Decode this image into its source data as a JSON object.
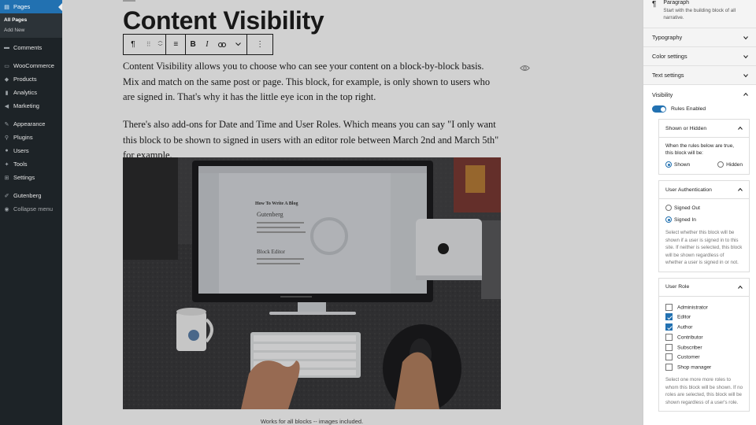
{
  "admin_menu": {
    "pages": "Pages",
    "pages_sub": [
      "All Pages",
      "Add New"
    ],
    "comments": "Comments",
    "woocommerce": "WooCommerce",
    "products": "Products",
    "analytics": "Analytics",
    "marketing": "Marketing",
    "appearance": "Appearance",
    "plugins": "Plugins",
    "users": "Users",
    "tools": "Tools",
    "settings": "Settings",
    "gutenberg": "Gutenberg",
    "collapse": "Collapse menu"
  },
  "post": {
    "title": "Content Visibility",
    "paragraph1": "Content Visibility allows you to choose who can see your content on a block-by-block basis. Mix and match on the same post or page. This block, for example, is only shown to users who are signed in. That's why it has the little eye icon in the top right.",
    "paragraph2": "There's also add-ons for Date and Time and User Roles. Which means you can say \"I only want this block to be shown to signed in users with an editor role between March 2nd and March 5th\" for example.",
    "caption": "Works for all blocks -- images included.",
    "photo_screen": {
      "heading": "How To Write A Blog",
      "sub1": "Gutenberg",
      "sub2": "Block Editor"
    }
  },
  "toolbar": {
    "paragraph_icon": "¶",
    "drag_icon": "⠿",
    "align_icon": "≡",
    "bold": "B",
    "italic": "I",
    "link_icon": "🔗",
    "more_icon": "⌄",
    "options_icon": "⋮"
  },
  "inspector": {
    "block_icon": "¶",
    "block_name": "Paragraph",
    "block_desc": "Start with the building block of all narrative.",
    "panels": {
      "typography": "Typography",
      "color": "Color settings",
      "text": "Text settings",
      "visibility": "Visibility"
    },
    "rules_enabled": "Rules Enabled",
    "shown_hidden": {
      "title": "Shown or Hidden",
      "desc": "When the rules below are true, this block will be:",
      "shown": "Shown",
      "hidden": "Hidden",
      "selected": "Shown"
    },
    "user_auth": {
      "title": "User Authentication",
      "signed_out": "Signed Out",
      "signed_in": "Signed In",
      "selected": "Signed In",
      "help": "Select whether this block will be shown if a user is signed in to this site. If neither is selected, this block will be shown regardless of whether a user is signed in or not."
    },
    "user_role": {
      "title": "User Role",
      "roles": [
        {
          "label": "Administrator",
          "checked": false
        },
        {
          "label": "Editor",
          "checked": true
        },
        {
          "label": "Author",
          "checked": true
        },
        {
          "label": "Contributor",
          "checked": false
        },
        {
          "label": "Subscriber",
          "checked": false
        },
        {
          "label": "Customer",
          "checked": false
        },
        {
          "label": "Shop manager",
          "checked": false
        }
      ],
      "help": "Select one more more roles to whom this block will be shown. If no roles are selected, this block will be shown regardless of a user's role."
    }
  },
  "colors": {
    "admin_bg": "#1d2327",
    "accent": "#2271b1",
    "active_panel_bg": "#ffffff"
  }
}
